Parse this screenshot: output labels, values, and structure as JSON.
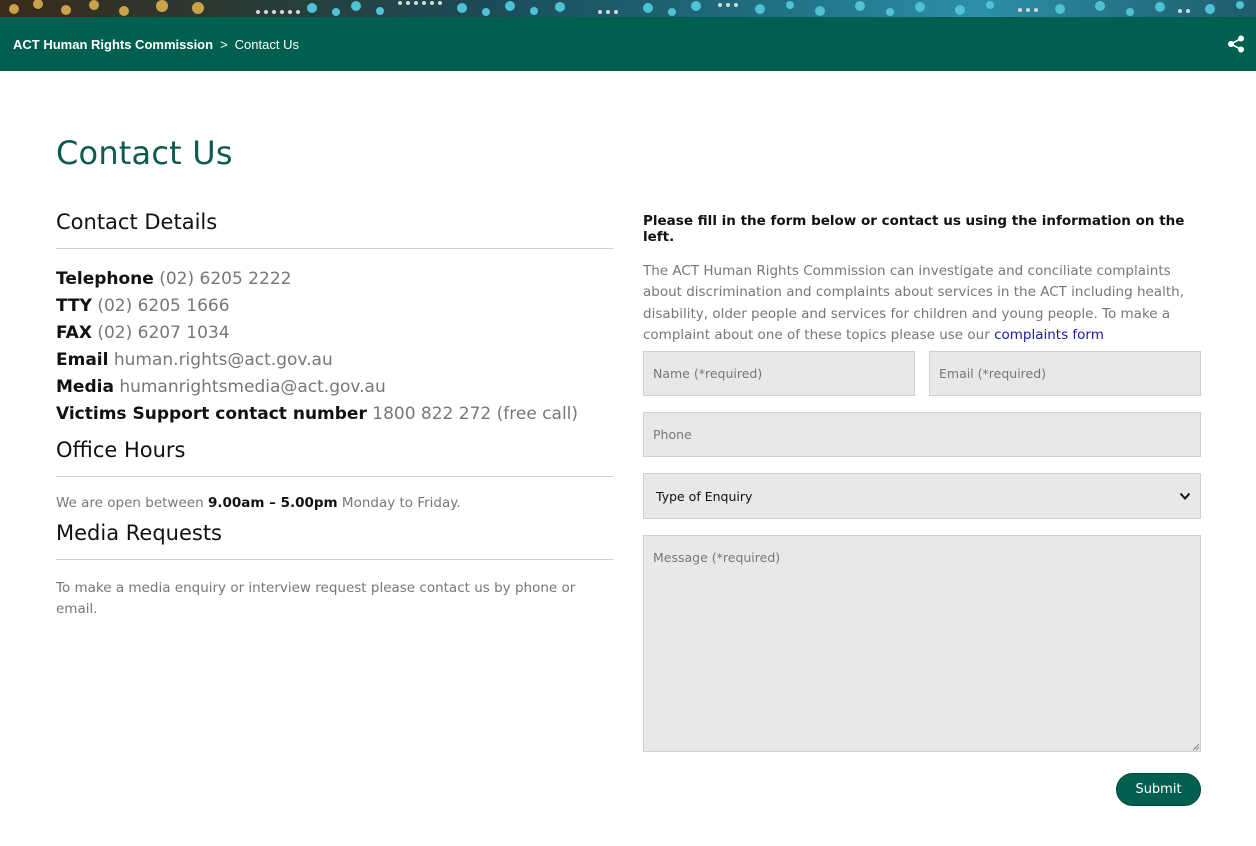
{
  "breadcrumb": {
    "home": "ACT Human Rights Commission",
    "separator": ">",
    "current": "Contact Us"
  },
  "page": {
    "title": "Contact Us"
  },
  "contact": {
    "heading": "Contact Details",
    "items": [
      {
        "label": "Telephone",
        "value": "(02) 6205 2222"
      },
      {
        "label": "TTY",
        "value": "(02) 6205 1666"
      },
      {
        "label": "FAX",
        "value": "(02) 6207 1034"
      },
      {
        "label": "Email",
        "value": "human.rights@act.gov.au"
      },
      {
        "label": "Media",
        "value": "humanrightsmedia@act.gov.au"
      },
      {
        "label": "Victims Support contact number",
        "value": "1800 822 272 (free call)"
      }
    ]
  },
  "hours": {
    "heading": "Office Hours",
    "prefix": "We are open between",
    "time": "9.00am – 5.00pm",
    "suffix": "Monday to Friday."
  },
  "media": {
    "heading": "Media Requests",
    "text": "To make a media enquiry or interview request please contact us by phone or email."
  },
  "form": {
    "lead": "Please fill in the form below or contact us using the information on the left.",
    "intro": "The ACT Human Rights Commission can investigate and conciliate complaints about discrimination and complaints about services in the ACT including health, disability, older people and services for children and young people. To make a complaint about one of these topics please use our",
    "intro_link": "complaints form",
    "name_placeholder": "Name (*required)",
    "email_placeholder": "Email (*required)",
    "phone_placeholder": "Phone",
    "enquiry_selected": "Type of Enquiry",
    "message_placeholder": "Message (*required)",
    "submit_label": "Submit"
  },
  "icons": {
    "share": "share-icon",
    "select_arrow": "chevron-down-icon"
  },
  "colors": {
    "brand_green": "#00604f",
    "title_green": "#0e5b52",
    "link_blue": "#1a1aa6",
    "field_bg": "#e8e8e8"
  }
}
